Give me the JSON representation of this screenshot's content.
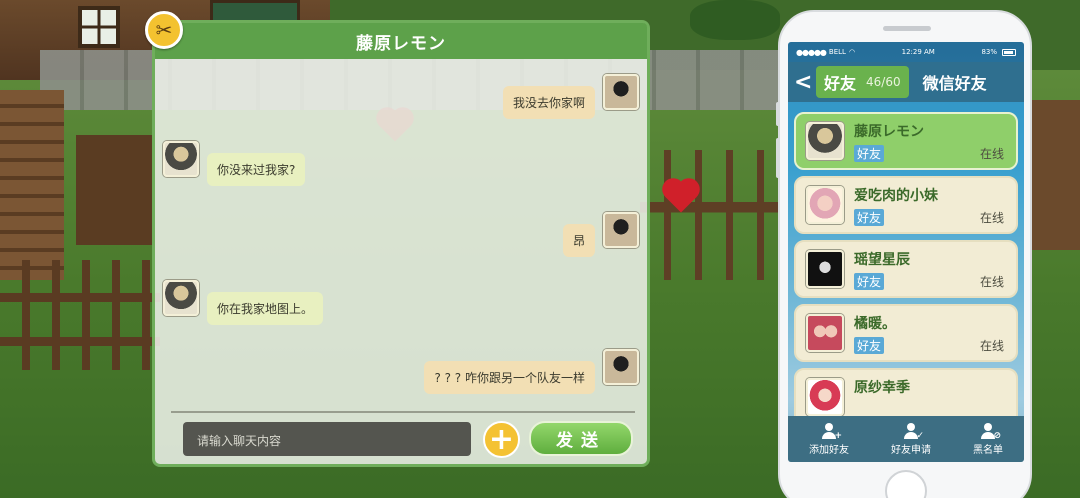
{
  "chat": {
    "title": "藤原レモン",
    "close_icon_glyph": "✂",
    "messages": [
      {
        "from": "me",
        "text": "我没去你家啊"
      },
      {
        "from": "friend",
        "text": "你没来过我家?"
      },
      {
        "from": "me",
        "text": "昂"
      },
      {
        "from": "friend",
        "text": "你在我家地图上。"
      },
      {
        "from": "me",
        "text": "? ? ? 咋你跟另一个队友一样"
      }
    ],
    "input_placeholder": "请输入聊天内容",
    "plus_glyph": "+",
    "send_label": "发送"
  },
  "phone": {
    "status": {
      "carrier": "BELL",
      "time": "12:29 AM",
      "battery": "83%"
    },
    "back_glyph": "<",
    "tab_friends_label": "好友",
    "tab_friends_count": "46/60",
    "tab_wechat_label": "微信好友",
    "friends": [
      {
        "name": "藤原レモン",
        "tag": "好友",
        "status": "在线",
        "selected": true
      },
      {
        "name": "爱吃肉的小妹",
        "tag": "好友",
        "status": "在线",
        "selected": false
      },
      {
        "name": "瑶望星辰",
        "tag": "好友",
        "status": "在线",
        "selected": false
      },
      {
        "name": "橘暖。",
        "tag": "好友",
        "status": "在线",
        "selected": false
      },
      {
        "name": "原纱幸季",
        "tag": "",
        "status": "",
        "selected": false
      }
    ],
    "footer": [
      {
        "label": "添加好友",
        "icon": "add-friend-icon",
        "badge": "+"
      },
      {
        "label": "好友申请",
        "icon": "friend-request-icon",
        "badge": "✓"
      },
      {
        "label": "黑名单",
        "icon": "blacklist-icon",
        "badge": "⊘"
      }
    ]
  },
  "colors": {
    "accent_green": "#5da14a",
    "send_green": "#6fbf4a",
    "gold": "#f4c233",
    "phone_header": "#2f6f8f",
    "friend_tag_blue": "#5aa9d6"
  }
}
